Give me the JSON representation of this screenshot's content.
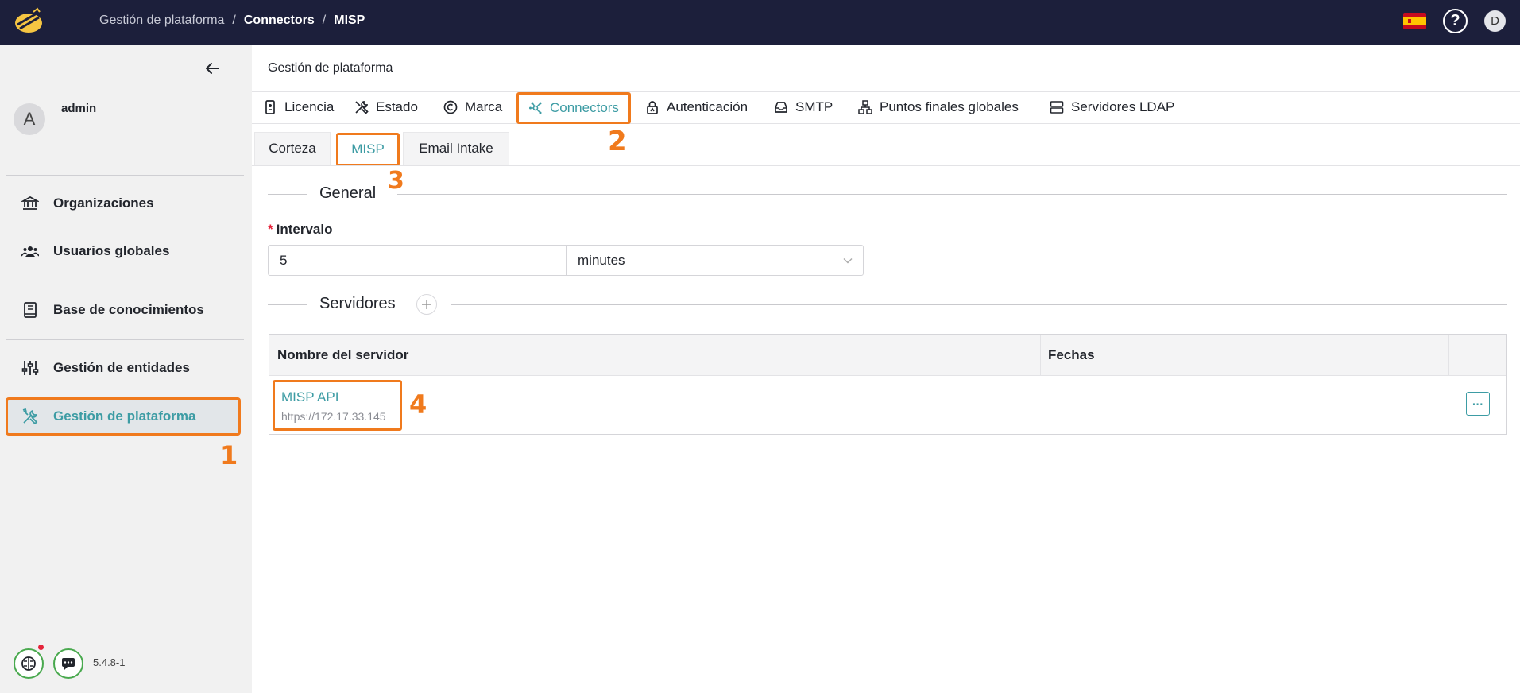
{
  "topbar": {
    "breadcrumb": [
      "Gestión de plataforma",
      "Connectors",
      "MISP"
    ],
    "help_label": "?",
    "user_initial": "D",
    "bg_color": "#1c1f3b"
  },
  "sidebar": {
    "user_initial": "A",
    "username": "admin",
    "items": [
      {
        "label": "Organizaciones",
        "icon": "bank-icon"
      },
      {
        "label": "Usuarios globales",
        "icon": "users-icon"
      },
      {
        "label": "Base de conocimientos",
        "icon": "book-icon"
      },
      {
        "label": "Gestión de entidades",
        "icon": "sliders-icon"
      },
      {
        "label": "Gestión de plataforma",
        "icon": "tools-icon"
      }
    ],
    "active_item": "Gestión de plataforma",
    "version": "5.4.8-1"
  },
  "annotations": [
    "1",
    "2",
    "3",
    "4"
  ],
  "main": {
    "title": "Gestión de plataforma",
    "tabs": [
      {
        "label": "Licencia",
        "icon": "license-icon"
      },
      {
        "label": "Estado",
        "icon": "tools-icon"
      },
      {
        "label": "Marca",
        "icon": "copyright-icon"
      },
      {
        "label": "Connectors",
        "icon": "network-icon"
      },
      {
        "label": "Autenticación",
        "icon": "lock-icon"
      },
      {
        "label": "SMTP",
        "icon": "inbox-icon"
      },
      {
        "label": "Puntos finales globales",
        "icon": "sitemap-icon"
      },
      {
        "label": "Servidores LDAP",
        "icon": "server-icon"
      }
    ],
    "active_tab": "Connectors",
    "subtabs": [
      "Corteza",
      "MISP",
      "Email Intake"
    ],
    "active_subtab": "MISP",
    "general": {
      "section_title": "General",
      "interval_label": "Intervalo",
      "interval_value": "5",
      "interval_unit": "minutes"
    },
    "servers": {
      "section_title": "Servidores",
      "columns": [
        "Nombre del servidor",
        "Fechas"
      ],
      "rows": [
        {
          "name": "MISP API",
          "url": "https://172.17.33.145"
        }
      ],
      "more_label": "···"
    }
  },
  "colors": {
    "accent": "#3d9ca4",
    "highlight": "#f07a1d",
    "required": "#e5243b"
  }
}
